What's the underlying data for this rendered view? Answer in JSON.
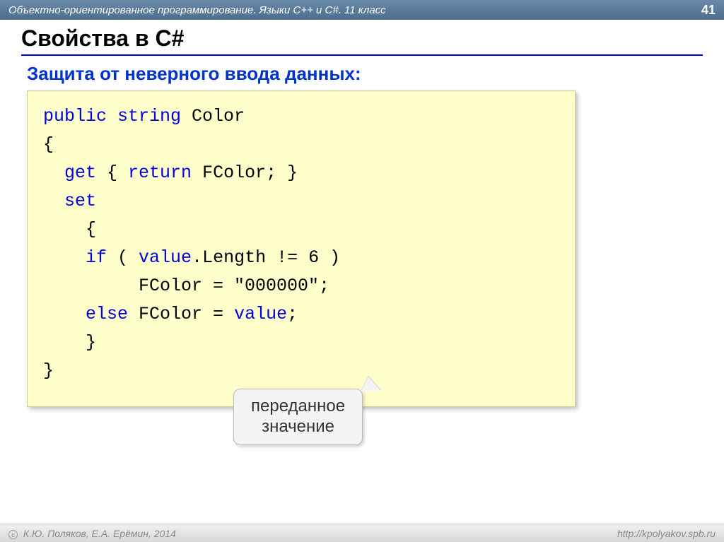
{
  "header": {
    "title": "Объектно-ориентированное программирование. Языки C++ и C#. 11 класс",
    "page": "41"
  },
  "slide": {
    "title": "Свойства в C#",
    "subtitle": "Защита от неверного ввода данных:"
  },
  "code": {
    "l1_kw1": "public",
    "l1_kw2": "string",
    "l1_txt": " Color",
    "l2": "{",
    "l3_kw1": "get",
    "l3_txt1": " { ",
    "l3_kw2": "return",
    "l3_txt2": " FColor; }",
    "l4_kw": "set",
    "l5": "    {",
    "l6_kw": "if",
    "l6_txt1": " ( ",
    "l6_kw2": "value",
    "l6_txt2": ".Length != 6 )",
    "l7": "         FColor = \"000000\";",
    "l8_kw": "else",
    "l8_txt1": " FColor = ",
    "l8_kw2": "value",
    "l8_txt2": ";",
    "l9": "    }",
    "l10": "}"
  },
  "callout": {
    "line1": "переданное",
    "line2": "значение"
  },
  "footer": {
    "copyright": "К.Ю. Поляков, Е.А. Ерёмин, 2014",
    "url": "http://kpolyakov.spb.ru"
  }
}
